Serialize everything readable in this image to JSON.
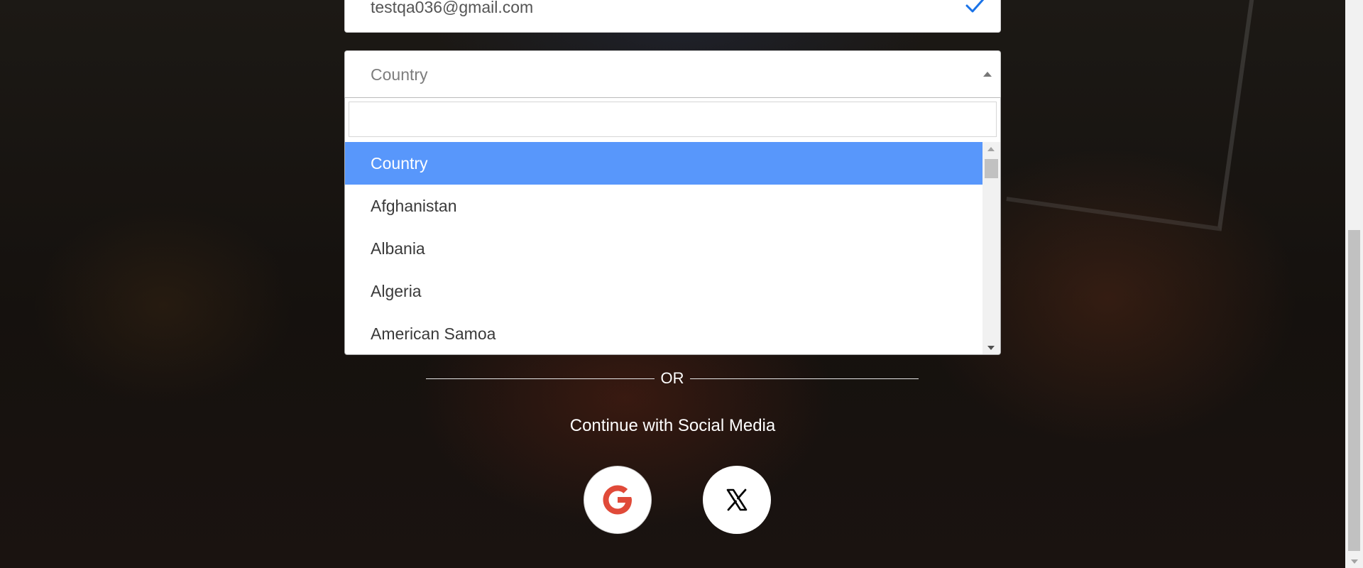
{
  "email": {
    "value": "testqa036@gmail.com",
    "check_icon": "checkmark-icon"
  },
  "country_select": {
    "selected_label": "Country",
    "caret_icon": "caret-up-icon",
    "search_value": "",
    "options": [
      {
        "label": "Country",
        "highlighted": true
      },
      {
        "label": "Afghanistan",
        "highlighted": false
      },
      {
        "label": "Albania",
        "highlighted": false
      },
      {
        "label": "Algeria",
        "highlighted": false
      },
      {
        "label": "American Samoa",
        "highlighted": false
      }
    ],
    "highlight_color": "#5897fb"
  },
  "divider": {
    "text": "OR"
  },
  "social": {
    "title": "Continue with Social Media",
    "buttons": [
      {
        "name": "google",
        "icon": "google-icon"
      },
      {
        "name": "x",
        "icon": "x-icon"
      }
    ]
  }
}
